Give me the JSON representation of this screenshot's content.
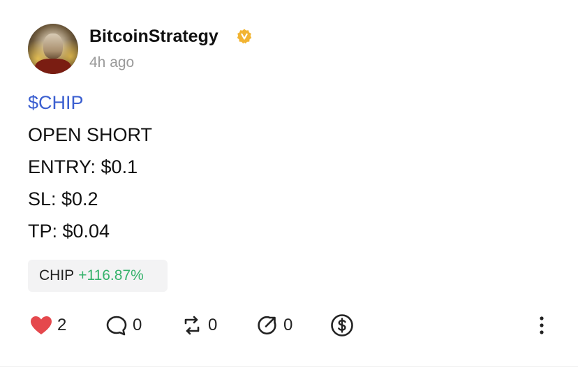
{
  "author": {
    "name": "BitcoinStrategy",
    "verified": true,
    "verified_icon": "verified-badge-icon",
    "timestamp": "4h ago"
  },
  "post": {
    "ticker_link": "$CHIP",
    "lines": [
      "OPEN SHORT",
      "ENTRY: $0.1",
      "SL: $0.2",
      "TP: $0.04"
    ]
  },
  "token_chip": {
    "symbol": "CHIP",
    "change": "+116.87%",
    "change_color": "#35b26b"
  },
  "actions": {
    "likes": "2",
    "comments": "0",
    "reposts": "0",
    "shares": "0"
  },
  "colors": {
    "link": "#3b5fd0",
    "like": "#e5484d",
    "verified": "#f2b431"
  }
}
